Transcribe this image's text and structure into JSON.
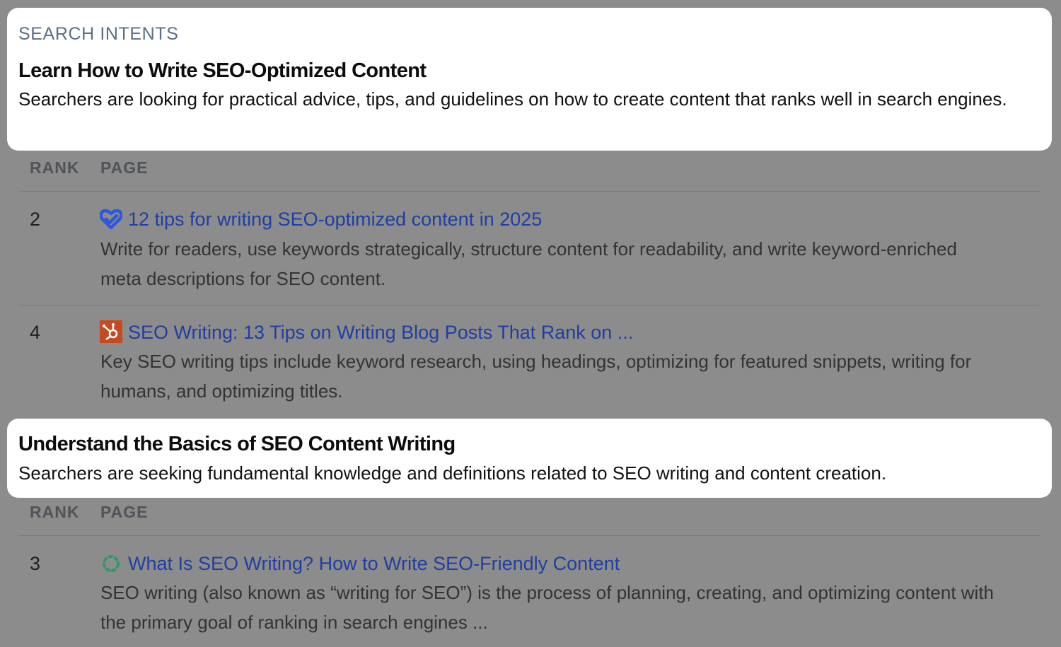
{
  "intents": [
    {
      "section_label": "SEARCH INTENTS",
      "title": "Learn How to Write SEO-Optimized Content",
      "description": "Searchers are looking for practical advice, tips, and guidelines on how to create content that ranks well in search engines.",
      "columns": {
        "rank": "RANK",
        "page": "PAGE"
      },
      "results": [
        {
          "rank": "2",
          "favicon": "heart-check-icon",
          "title": "12 tips for writing SEO-optimized content in 2025",
          "description": "Write for readers, use keywords strategically, structure content for readability, and write keyword-enriched meta descriptions for SEO content."
        },
        {
          "rank": "4",
          "favicon": "hubspot-sprocket-icon",
          "title": "SEO Writing: 13 Tips on Writing Blog Posts That Rank on ...",
          "description": "Key SEO writing tips include keyword research, using headings, optimizing for featured snippets, writing for humans, and optimizing titles."
        }
      ]
    },
    {
      "title": "Understand the Basics of SEO Content Writing",
      "description": "Searchers are seeking fundamental knowledge and definitions related to SEO writing and content creation.",
      "columns": {
        "rank": "RANK",
        "page": "PAGE"
      },
      "results": [
        {
          "rank": "3",
          "favicon": "green-ring-icon",
          "title": "What Is SEO Writing? How to Write SEO-Friendly Content",
          "description": "SEO writing (also known as “writing for SEO”) is the process of planning, creating, and optimizing content with the primary goal of ranking in search engines ..."
        }
      ]
    }
  ],
  "colors": {
    "overlay": "#8c8c8c",
    "link": "#1f3fa3",
    "label": "#5a6f86",
    "favicon_heart": "#2f57d9",
    "favicon_hubspot": "#c44a1f",
    "favicon_ring": "#2e9a66"
  }
}
